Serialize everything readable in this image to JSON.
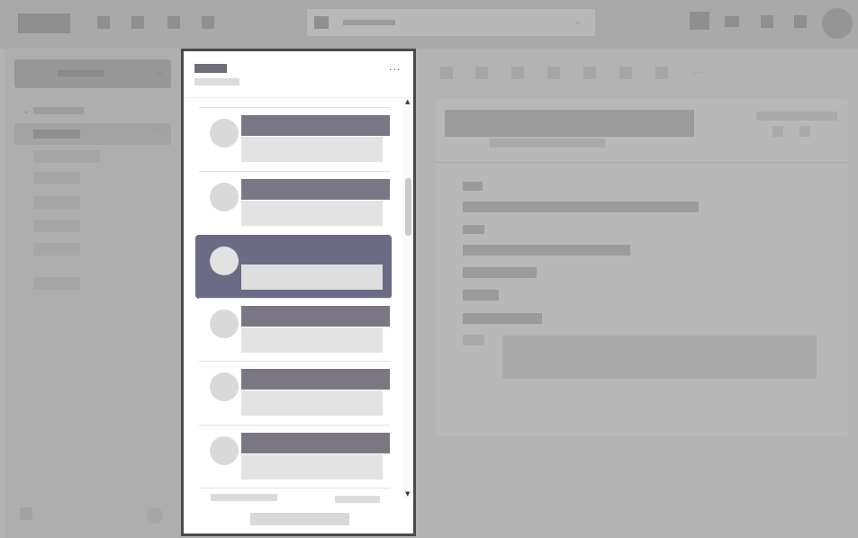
{
  "colors": {
    "backdrop": "#b3b3b3",
    "selected_item": "#6b6b86",
    "name_block": "#7a7683",
    "preview_block": "#e3e3e3",
    "panel_border": "#4a4a4a"
  },
  "icons": {
    "panel_more": "more-horizontal-icon",
    "scroll_up": "chevron-up-icon",
    "scroll_down": "chevron-down-icon",
    "sidebar_expand": "chevron-down-icon",
    "search": "search-icon",
    "user": "avatar-icon"
  },
  "panel": {
    "more_glyph": "···",
    "scroll_up_glyph": "▲",
    "scroll_down_glyph": "▼",
    "items": [
      {
        "state": "normal"
      },
      {
        "state": "normal"
      },
      {
        "state": "selected"
      },
      {
        "state": "normal"
      },
      {
        "state": "normal"
      },
      {
        "state": "normal"
      }
    ]
  },
  "background": {
    "search_chevron": "⌄",
    "dropdown_chevron": "⌄",
    "tree_chevron": "⌄",
    "sidebar_more": "···",
    "content_more": "···"
  }
}
